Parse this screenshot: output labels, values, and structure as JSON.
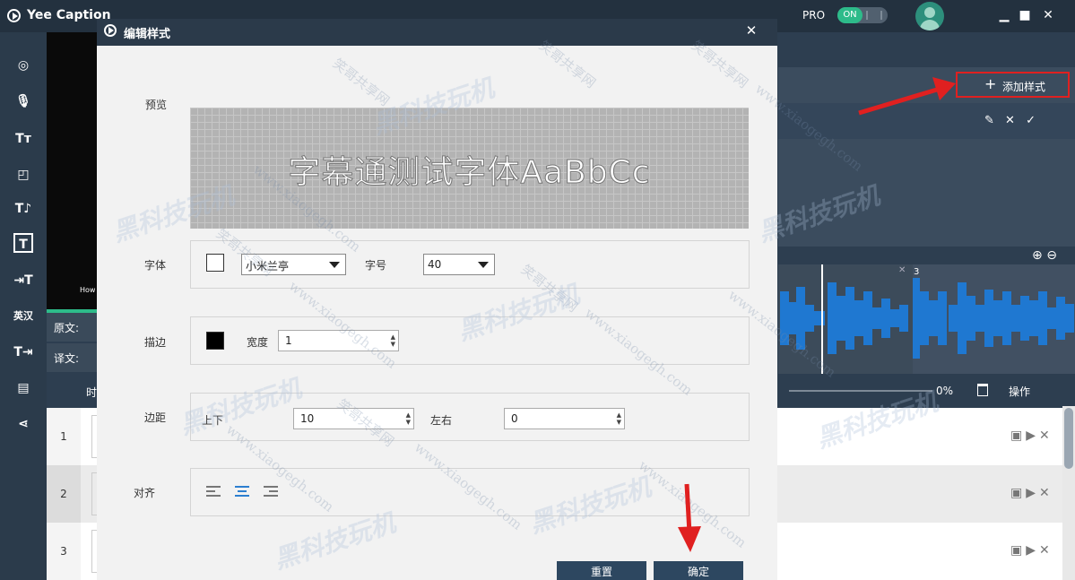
{
  "app": {
    "title": "Yee Caption",
    "pro_label": "PRO",
    "toggle_label": "ON",
    "window_controls": [
      "minimize-icon",
      "maximize-icon",
      "close-icon"
    ]
  },
  "left_toolbar": {
    "icons": [
      "cursor-icon",
      "microphone-icon",
      "text-size-icon",
      "shapes-icon",
      "voice-text-icon",
      "text-box-icon",
      "text-import-icon",
      "translate-icon",
      "text-export-icon",
      "film-icon",
      "share-icon"
    ],
    "translate_glyph_1": "英",
    "translate_glyph_2": "汉"
  },
  "video": {
    "overlay_text": "How"
  },
  "subtitle_labels": {
    "original": "原文:",
    "translation": "译文:"
  },
  "style_panel": {
    "add_style_label": "添加样式",
    "row_action_icons": [
      "pencil-icon",
      "close-icon",
      "check-icon"
    ]
  },
  "waveform": {
    "segment_number": "3",
    "zoom_icons": [
      "zoom-in-icon",
      "zoom-out-icon"
    ]
  },
  "table": {
    "header_time_partial": "时",
    "progress_percent": "0%",
    "operation_header": "操作",
    "rows": [
      {
        "index": "1"
      },
      {
        "index": "2"
      },
      {
        "index": "3"
      }
    ]
  },
  "dialog": {
    "title": "编辑样式",
    "preview_label": "预览",
    "preview_text": "字幕通测试字体AaBbCc",
    "font_label": "字体",
    "font_color": "#ffffff",
    "font_name": "小米兰亭",
    "font_size_label": "字号",
    "font_size_value": "40",
    "stroke_label": "描边",
    "stroke_color": "#000000",
    "stroke_width_label": "宽度",
    "stroke_width_value": "1",
    "margin_label": "边距",
    "margin_vertical_label": "上下",
    "margin_vertical_value": "10",
    "margin_horizontal_label": "左右",
    "margin_horizontal_value": "0",
    "align_label": "对齐",
    "align_selected": "center",
    "reset_label": "重置",
    "confirm_label": "确定"
  },
  "watermarks": {
    "site": "www.xiaogegh.com",
    "name": "笑哥共享网",
    "brand": "黑科技玩机"
  },
  "colors": {
    "titlebar": "#23313f",
    "accent_green": "#2dbb8a",
    "wave_blue": "#1f78d1",
    "highlight_red": "#e02020",
    "dialog_button": "#2d4760"
  }
}
